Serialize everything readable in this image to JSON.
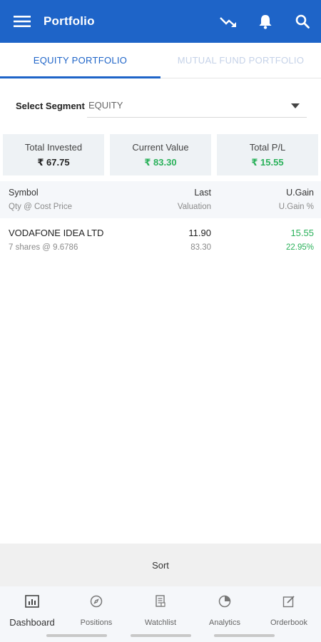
{
  "appbar": {
    "title": "Portfolio",
    "menu_icon": "menu-icon",
    "actions": [
      "trend-down-icon",
      "bell-icon",
      "search-icon"
    ]
  },
  "tabs": [
    {
      "label": "EQUITY PORTFOLIO",
      "active": true
    },
    {
      "label": "MUTUAL FUND PORTFOLIO",
      "active": false
    }
  ],
  "segment": {
    "label": "Select Segment",
    "value": "EQUITY"
  },
  "summary": {
    "total_invested": {
      "label": "Total Invested",
      "value": "₹ 67.75"
    },
    "current_value": {
      "label": "Current Value",
      "value": "₹ 83.30"
    },
    "total_pl": {
      "label": "Total P/L",
      "value": "₹ 15.55"
    }
  },
  "table": {
    "headers": {
      "symbol": "Symbol",
      "last": "Last",
      "ugain": "U.Gain",
      "qty_cost": "Qty @ Cost Price",
      "valuation": "Valuation",
      "ugain_pct": "U.Gain %"
    },
    "rows": [
      {
        "symbol": "VODAFONE IDEA LTD",
        "last": "11.90",
        "ugain": "15.55",
        "qty_cost": "7 shares @ 9.6786",
        "valuation": "83.30",
        "ugain_pct": "22.95%"
      }
    ]
  },
  "sort_label": "Sort",
  "bottom_nav": [
    {
      "label": "Dashboard",
      "icon": "dashboard-icon",
      "active": true
    },
    {
      "label": "Positions",
      "icon": "compass-icon",
      "active": false
    },
    {
      "label": "Watchlist",
      "icon": "watchlist-icon",
      "active": false
    },
    {
      "label": "Analytics",
      "icon": "pie-chart-icon",
      "active": false
    },
    {
      "label": "Orderbook",
      "icon": "edit-icon",
      "active": false
    }
  ],
  "colors": {
    "primary": "#1e64c8",
    "gain": "#2ab15a",
    "card_bg": "#eef2f5"
  }
}
